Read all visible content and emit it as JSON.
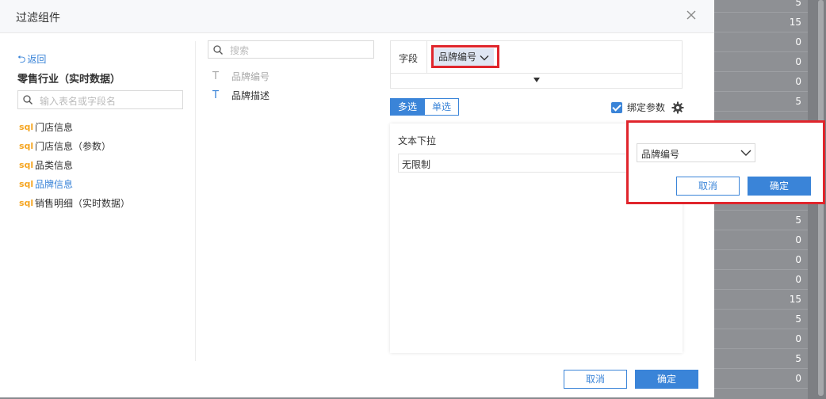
{
  "dialog": {
    "title": "过滤组件",
    "close_icon": "close-icon"
  },
  "left_panel": {
    "back_label": "返回",
    "db_title": "零售行业（实时数据）",
    "search_placeholder": "输入表名或字段名",
    "tables": [
      {
        "icon": "sql",
        "label": "门店信息",
        "active": false
      },
      {
        "icon": "sql",
        "label": "门店信息（参数）",
        "active": false
      },
      {
        "icon": "sql",
        "label": "品类信息",
        "active": false
      },
      {
        "icon": "sql",
        "label": "品牌信息",
        "active": true
      },
      {
        "icon": "sql",
        "label": "销售明细（实时数据）",
        "active": false
      }
    ]
  },
  "middle_panel": {
    "search_placeholder": "搜索",
    "fields": [
      {
        "icon": "T",
        "label": "品牌编号",
        "disabled": true
      },
      {
        "icon": "T",
        "label": "品牌描述",
        "disabled": false
      }
    ]
  },
  "config": {
    "field_label": "字段",
    "field_tag": "品牌编号",
    "mode_multi": "多选",
    "mode_single": "单选",
    "bind_param_label": "绑定参数",
    "bind_param_checked": true,
    "preview_title": "文本下拉",
    "preview_value": "无限制"
  },
  "popup": {
    "select_value": "品牌编号",
    "cancel_label": "取消",
    "ok_label": "确定"
  },
  "footer": {
    "cancel_label": "取消",
    "ok_label": "确定"
  },
  "background_table": {
    "values": [
      "5",
      "15",
      "0",
      "0",
      "0",
      "5",
      "",
      "",
      "",
      "",
      "",
      "5",
      "0",
      "0",
      "0",
      "15",
      "5",
      "0",
      "5",
      "0"
    ]
  },
  "colors": {
    "accent": "#3a84d8",
    "highlight": "#e0252c",
    "sql_icon": "#f5a623"
  }
}
